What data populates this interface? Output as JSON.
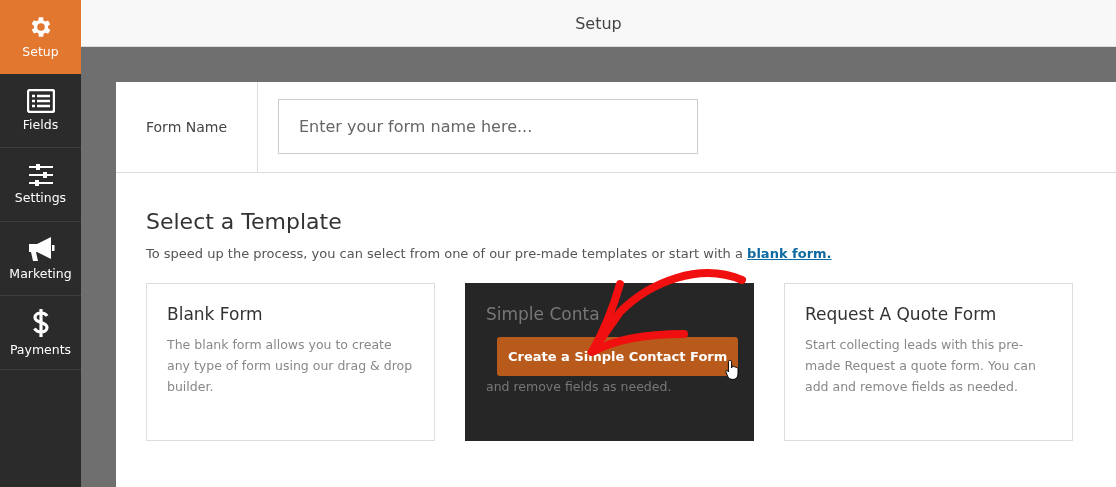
{
  "sidebar": {
    "items": [
      {
        "label": "Setup",
        "selected": true
      },
      {
        "label": "Fields",
        "selected": false
      },
      {
        "label": "Settings",
        "selected": false
      },
      {
        "label": "Marketing",
        "selected": false
      },
      {
        "label": "Payments",
        "selected": false
      }
    ]
  },
  "header": {
    "title": "Setup"
  },
  "form_name": {
    "label": "Form Name",
    "placeholder": "Enter your form name here..."
  },
  "templates": {
    "heading": "Select a Template",
    "intro": "To speed up the process, you can select from one of our pre-made templates or start with a",
    "intro_link": "blank form.",
    "cards": [
      {
        "title": "Blank Form",
        "description": "The blank form allows you to create any type of form using our drag & drop builder.",
        "hovered": false
      },
      {
        "title": "Simple Conta",
        "description": "and remove fields as needed.",
        "hovered": true,
        "button": "Create a Simple Contact Form"
      },
      {
        "title": "Request A Quote Form",
        "description": "Start collecting leads with this pre-made Request a quote form. You can add and remove fields as needed.",
        "hovered": false
      }
    ]
  }
}
